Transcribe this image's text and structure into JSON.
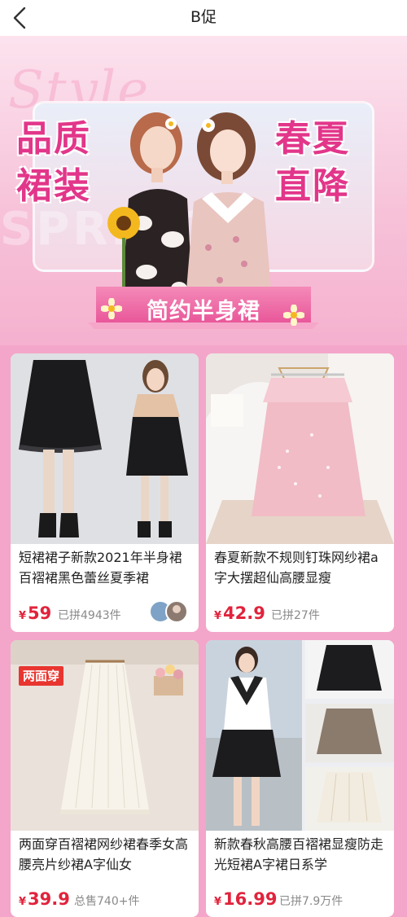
{
  "header": {
    "title": "B促"
  },
  "banner": {
    "script_text": "Style",
    "spring_text": "SPRING",
    "headline_left": "品质\n裙装",
    "headline_right": "春夏\n直降",
    "ribbon_label": "简约半身裙"
  },
  "products": [
    {
      "title": "短裙裙子新款2021年半身裙百褶裙黑色蕾丝夏季裙",
      "currency": "¥",
      "price": "59",
      "sales": "已拼4943件",
      "badge": ""
    },
    {
      "title": "春夏新款不规则钉珠网纱裙a字大摆超仙高腰显瘦",
      "currency": "¥",
      "price": "42.9",
      "sales": "已拼27件",
      "badge": ""
    },
    {
      "title": "两面穿百褶裙网纱裙春季女高腰亮片纱裙A字仙女",
      "currency": "¥",
      "price": "39.9",
      "sales": "总售740+件",
      "badge": "两面穿"
    },
    {
      "title": "新款春秋高腰百褶裙显瘦防走光短裙A字裙日系学",
      "currency": "¥",
      "price": "16.99",
      "sales": "已拼7.9万件",
      "badge": ""
    }
  ],
  "colors": {
    "accent": "#e2368a",
    "price": "#e1233c",
    "page_bg": "#f3a6c9"
  }
}
